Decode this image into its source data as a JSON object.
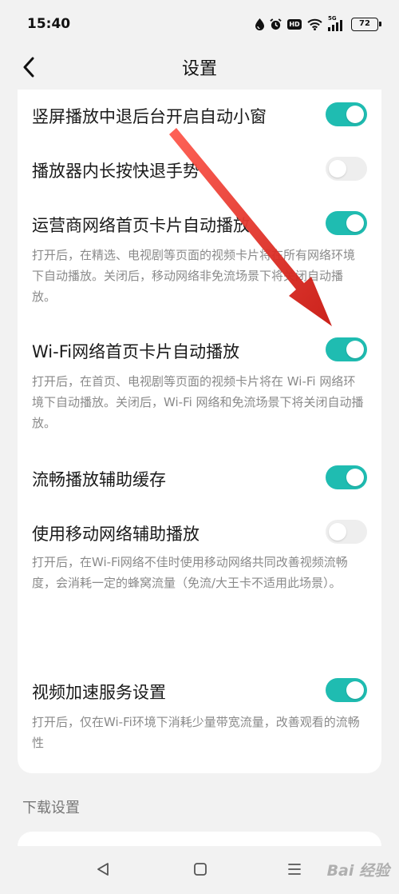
{
  "status_bar": {
    "time": "15:40",
    "network_label": "5G",
    "hd_label": "HD",
    "battery": "72"
  },
  "header": {
    "title": "设置"
  },
  "settings": [
    {
      "title": "竖屏播放中退后台开启自动小窗",
      "enabled": true
    },
    {
      "title": "播放器内长按快退手势",
      "enabled": false
    },
    {
      "title": "运营商网络首页卡片自动播放",
      "enabled": true,
      "desc": "打开后，在精选、电视剧等页面的视频卡片将在所有网络环境下自动播放。关闭后，移动网络非免流场景下将关闭自动播放。"
    },
    {
      "title": "Wi-Fi网络首页卡片自动播放",
      "enabled": true,
      "desc": "打开后，在首页、电视剧等页面的视频卡片将在 Wi-Fi 网络环境下自动播放。关闭后，Wi-Fi 网络和免流场景下将关闭自动播放。"
    },
    {
      "title": "流畅播放辅助缓存",
      "enabled": true
    },
    {
      "title": "使用移动网络辅助播放",
      "enabled": false,
      "desc": "打开后，在Wi-Fi网络不佳时使用移动网络共同改善视频流畅度，会消耗一定的蜂窝流量（免流/大王卡不适用此场景）。"
    },
    {
      "title": "视频加速服务设置",
      "enabled": true,
      "desc": "打开后，仅在Wi-Fi环境下消耗少量带宽流量，改善观看的流畅性"
    }
  ],
  "sections": {
    "download_header": "下载设置"
  },
  "watermark": {
    "text": "Bai 经验"
  },
  "colors": {
    "toggle_on": "#1fbcb1",
    "toggle_off": "#eeeeee",
    "arrow": "#e0201c"
  },
  "icons": {
    "back": "chevron-left-icon",
    "nav_back": "triangle-back-icon",
    "nav_home": "square-home-icon",
    "nav_menu": "menu-icon"
  }
}
